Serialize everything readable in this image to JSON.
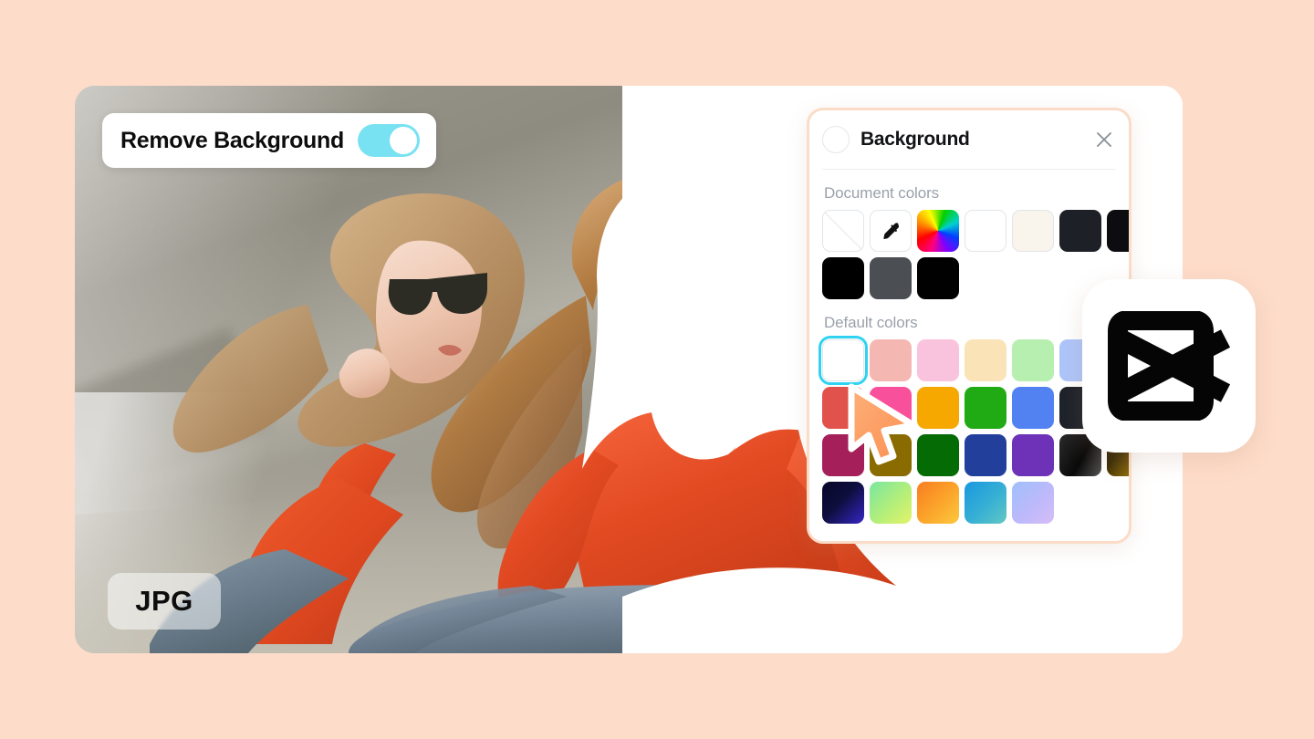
{
  "page": {
    "background_color": "#fddcc9",
    "card_color": "#ffffff"
  },
  "remove_background": {
    "label": "Remove Background",
    "toggle_state": "on",
    "toggle_color": "#79e2f2",
    "icon": "toggle-switch-icon"
  },
  "file_badge": {
    "label": "JPG"
  },
  "background_panel": {
    "title": "Background",
    "close_icon": "close-icon",
    "current_color_icon": "color-circle-icon",
    "sections": [
      {
        "label": "Document colors",
        "swatches": [
          {
            "name": "transparent",
            "color": "#ffffff",
            "style": "slash"
          },
          {
            "name": "eyedropper",
            "color": "#ffffff",
            "style": "eyedropper"
          },
          {
            "name": "rainbow-picker",
            "color": "rainbow",
            "style": "rainbow"
          },
          {
            "name": "white",
            "color": "#ffffff",
            "style": "bordered"
          },
          {
            "name": "cream",
            "color": "#f9f4ec",
            "style": "bordered"
          },
          {
            "name": "dark-navy",
            "color": "#1d2026",
            "style": "solid"
          },
          {
            "name": "near-black",
            "color": "#0d0d11",
            "style": "solid"
          },
          {
            "name": "black",
            "color": "#000000",
            "style": "solid"
          },
          {
            "name": "dark-gray",
            "color": "#4b4e53",
            "style": "solid"
          },
          {
            "name": "pure-black",
            "color": "#010101",
            "style": "solid"
          }
        ]
      },
      {
        "label": "Default colors",
        "swatches": [
          {
            "name": "white",
            "color": "#ffffff",
            "style": "bordered",
            "selected": true
          },
          {
            "name": "light-salmon",
            "color": "#f5b7b1",
            "style": "solid"
          },
          {
            "name": "light-pink",
            "color": "#f9c2dd",
            "style": "solid"
          },
          {
            "name": "light-peach",
            "color": "#fbe3b8",
            "style": "solid"
          },
          {
            "name": "light-green",
            "color": "#b6efb0",
            "style": "solid"
          },
          {
            "name": "light-blue",
            "color": "#aec5f9",
            "style": "solid"
          },
          {
            "name": "gray",
            "color": "#797979",
            "style": "solid"
          },
          {
            "name": "red",
            "color": "#e2524c",
            "style": "solid"
          },
          {
            "name": "hot-pink",
            "color": "#f9509b",
            "style": "solid"
          },
          {
            "name": "amber",
            "color": "#f6a800",
            "style": "solid"
          },
          {
            "name": "green",
            "color": "#20ab15",
            "style": "solid"
          },
          {
            "name": "blue",
            "color": "#5282f2",
            "style": "solid"
          },
          {
            "name": "charcoal",
            "color": "#1e222a",
            "style": "solid"
          },
          {
            "name": "brick-red",
            "color": "#c6362f",
            "style": "solid"
          },
          {
            "name": "magenta",
            "color": "#a51f5a",
            "style": "solid"
          },
          {
            "name": "olive-gold",
            "color": "#8a6b00",
            "style": "solid"
          },
          {
            "name": "dark-green",
            "color": "#046b05",
            "style": "solid"
          },
          {
            "name": "navy-blue",
            "color": "#22409b",
            "style": "solid"
          },
          {
            "name": "purple",
            "color": "#6d32b8",
            "style": "solid"
          },
          {
            "name": "gradient-black-gray",
            "color": "linear-gradient(120deg,#2b2b2b,#0a0a0a 55%,#555 100%)",
            "style": "gradient"
          },
          {
            "name": "gradient-gold-black",
            "color": "linear-gradient(130deg,#1a1404,#3a2c06 35%,#c99a10 100%)",
            "style": "gradient"
          },
          {
            "name": "gradient-navy-indigo",
            "color": "linear-gradient(135deg,#06062a,#0e0e3c 45%,#3526c7 100%)",
            "style": "gradient"
          },
          {
            "name": "gradient-green-yellow",
            "color": "linear-gradient(135deg,#79e6a0,#b9ef77 60%,#e4f36a 100%)",
            "style": "gradient"
          },
          {
            "name": "gradient-orange-yellow",
            "color": "linear-gradient(135deg,#fa7d20,#fba22a 50%,#fcc93c 100%)",
            "style": "gradient"
          },
          {
            "name": "gradient-blue-teal",
            "color": "linear-gradient(135deg,#1a97e0,#37b0d4 55%,#62c8c3 100%)",
            "style": "gradient"
          },
          {
            "name": "gradient-blue-lavender",
            "color": "linear-gradient(135deg,#9fc0fb,#bdb9fb 55%,#d6bdf6 100%)",
            "style": "gradient"
          }
        ]
      }
    ]
  },
  "capcut_logo": {
    "name": "capcut-logo-icon"
  },
  "cursor": {
    "name": "mouse-cursor-pointer",
    "color": "#fb9a5f"
  }
}
